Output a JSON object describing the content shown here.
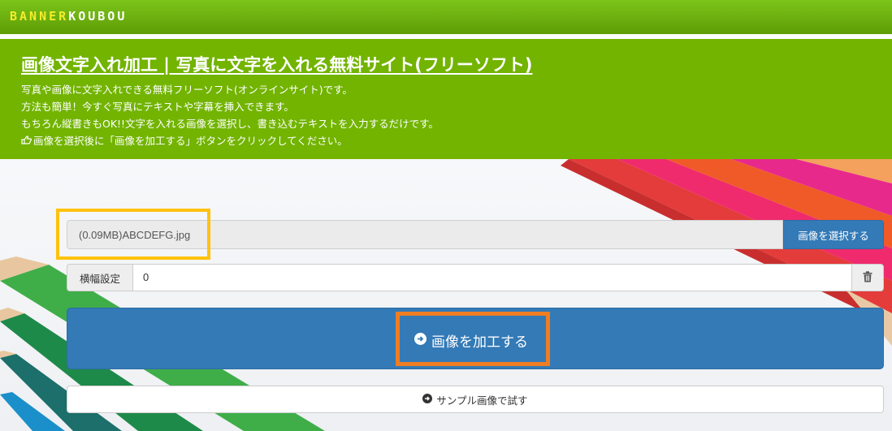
{
  "logo": {
    "part1": "BANNER",
    "part2": "KOUBOU"
  },
  "header": {
    "title": "画像文字入れ加工 | 写真に文字を入れる無料サイト(フリーソフト)",
    "lines": [
      "写真や画像に文字入れできる無料フリーソフト(オンラインサイト)です。",
      "方法も簡単！今すぐ写真にテキストや字幕を挿入できます。",
      "もちろん縦書きもOK!!文字を入れる画像を選択し、書き込むテキストを入力するだけです。",
      "画像を選択後に「画像を加工する」ボタンをクリックしてください。"
    ]
  },
  "file": {
    "name": "(0.09MB)ABCDEFG.jpg",
    "select_label": "画像を選択する"
  },
  "width_setting": {
    "label": "横幅設定",
    "value": "0"
  },
  "process_button": {
    "label": "画像を加工する"
  },
  "sample_button": {
    "label": "サンプル画像で試す"
  },
  "icons": {
    "hand": "hand-pointer-icon",
    "trash": "trash-icon",
    "arrow": "arrow-circle-right-icon"
  },
  "colors": {
    "topbar": "#5e9d06",
    "header": "#72b400",
    "primary": "#337ab7",
    "highlight_yellow": "#ffc20e",
    "highlight_orange": "#ef7d22"
  }
}
